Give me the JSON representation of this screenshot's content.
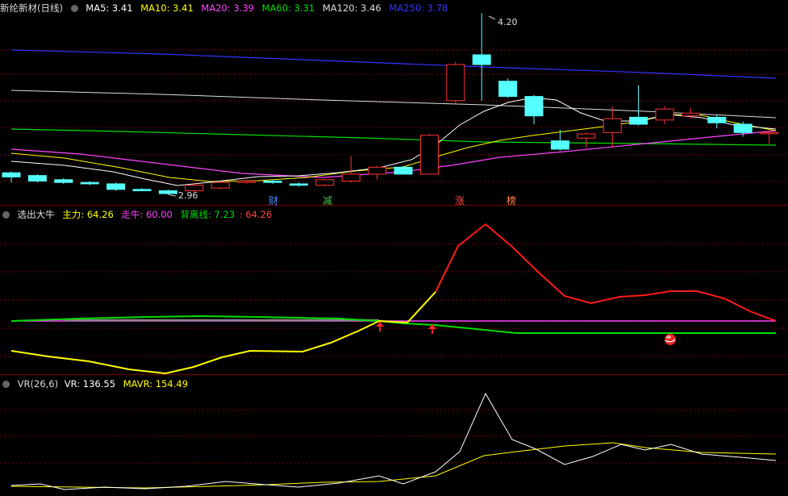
{
  "main": {
    "stock_title": "新纶新材(日线)",
    "ma_labels": [
      {
        "text": "MA5: 3.41",
        "color": "#ffffff"
      },
      {
        "text": "MA10: 3.41",
        "color": "#ffff00"
      },
      {
        "text": "MA20: 3.39",
        "color": "#ff44ff"
      },
      {
        "text": "MA60: 3.31",
        "color": "#00dd00"
      },
      {
        "text": "MA120: 3.46",
        "color": "#dddddd"
      },
      {
        "text": "MA250: 3.78",
        "color": "#3333ff"
      }
    ],
    "high_label": "4.20",
    "low_label": "2.96",
    "markers": [
      {
        "text": "财",
        "color": "#4488ff"
      },
      {
        "text": "减",
        "color": "#44cc44"
      },
      {
        "text": "涨",
        "color": "#ff4444"
      },
      {
        "text": "榜",
        "color": "#ff8844"
      }
    ],
    "candles": [
      {
        "o": 3.05,
        "c": 3.02,
        "h": 3.06,
        "l": 2.98
      },
      {
        "o": 3.03,
        "c": 2.99,
        "h": 3.04,
        "l": 2.98
      },
      {
        "o": 3.0,
        "c": 2.98,
        "h": 3.01,
        "l": 2.97
      },
      {
        "o": 2.98,
        "c": 2.97,
        "h": 2.99,
        "l": 2.96
      },
      {
        "o": 2.97,
        "c": 2.93,
        "h": 2.98,
        "l": 2.92
      },
      {
        "o": 2.93,
        "c": 2.92,
        "h": 2.94,
        "l": 2.92
      },
      {
        "o": 2.92,
        "c": 2.9,
        "h": 2.93,
        "l": 2.9
      },
      {
        "o": 2.92,
        "c": 2.96,
        "h": 2.98,
        "l": 2.91
      },
      {
        "o": 2.94,
        "c": 2.98,
        "h": 2.99,
        "l": 2.93
      },
      {
        "o": 2.98,
        "c": 2.99,
        "h": 3.0,
        "l": 2.97
      },
      {
        "o": 2.99,
        "c": 2.98,
        "h": 3.0,
        "l": 2.97
      },
      {
        "o": 2.97,
        "c": 2.96,
        "h": 2.98,
        "l": 2.95
      },
      {
        "o": 2.96,
        "c": 3.0,
        "h": 3.0,
        "l": 2.95
      },
      {
        "o": 2.99,
        "c": 3.04,
        "h": 3.17,
        "l": 2.98
      },
      {
        "o": 3.04,
        "c": 3.09,
        "h": 3.1,
        "l": 3.0
      },
      {
        "o": 3.09,
        "c": 3.04,
        "h": 3.1,
        "l": 3.04
      },
      {
        "o": 3.04,
        "c": 3.32,
        "h": 3.33,
        "l": 3.04
      },
      {
        "o": 3.57,
        "c": 3.83,
        "h": 3.85,
        "l": 3.55
      },
      {
        "o": 3.9,
        "c": 3.83,
        "h": 4.2,
        "l": 3.57
      },
      {
        "o": 3.71,
        "c": 3.6,
        "h": 3.73,
        "l": 3.59
      },
      {
        "o": 3.6,
        "c": 3.46,
        "h": 3.61,
        "l": 3.4
      },
      {
        "o": 3.28,
        "c": 3.22,
        "h": 3.36,
        "l": 3.21
      },
      {
        "o": 3.3,
        "c": 3.33,
        "h": 3.34,
        "l": 3.23
      },
      {
        "o": 3.34,
        "c": 3.44,
        "h": 3.53,
        "l": 3.23
      },
      {
        "o": 3.45,
        "c": 3.4,
        "h": 3.68,
        "l": 3.39
      },
      {
        "o": 3.43,
        "c": 3.51,
        "h": 3.53,
        "l": 3.4
      },
      {
        "o": 3.46,
        "c": 3.48,
        "h": 3.52,
        "l": 3.44
      },
      {
        "o": 3.45,
        "c": 3.41,
        "h": 3.47,
        "l": 3.37
      },
      {
        "o": 3.4,
        "c": 3.34,
        "h": 3.42,
        "l": 3.31
      },
      {
        "o": 3.34,
        "c": 3.34,
        "h": 3.35,
        "l": 3.26
      }
    ]
  },
  "indicator": {
    "name": "选出大牛",
    "zhuli": "主力: 64.26",
    "zouniu": "走牛: 60.00",
    "beilixian": "背离线: 7.23",
    "extra": ": 64.26"
  },
  "vr": {
    "name": "VR(26,6)",
    "vr": "VR: 136.55",
    "mavr": "MAVR: 154.49"
  },
  "colors": {
    "up": "#ff3333",
    "down": "#54ffff",
    "ma5": "#ffffff",
    "ma10": "#ffff00",
    "ma20": "#ff44ff",
    "ma60": "#00dd00",
    "ma120": "#dddddd",
    "ma250": "#3333ff",
    "grid": "#7a0000"
  }
}
